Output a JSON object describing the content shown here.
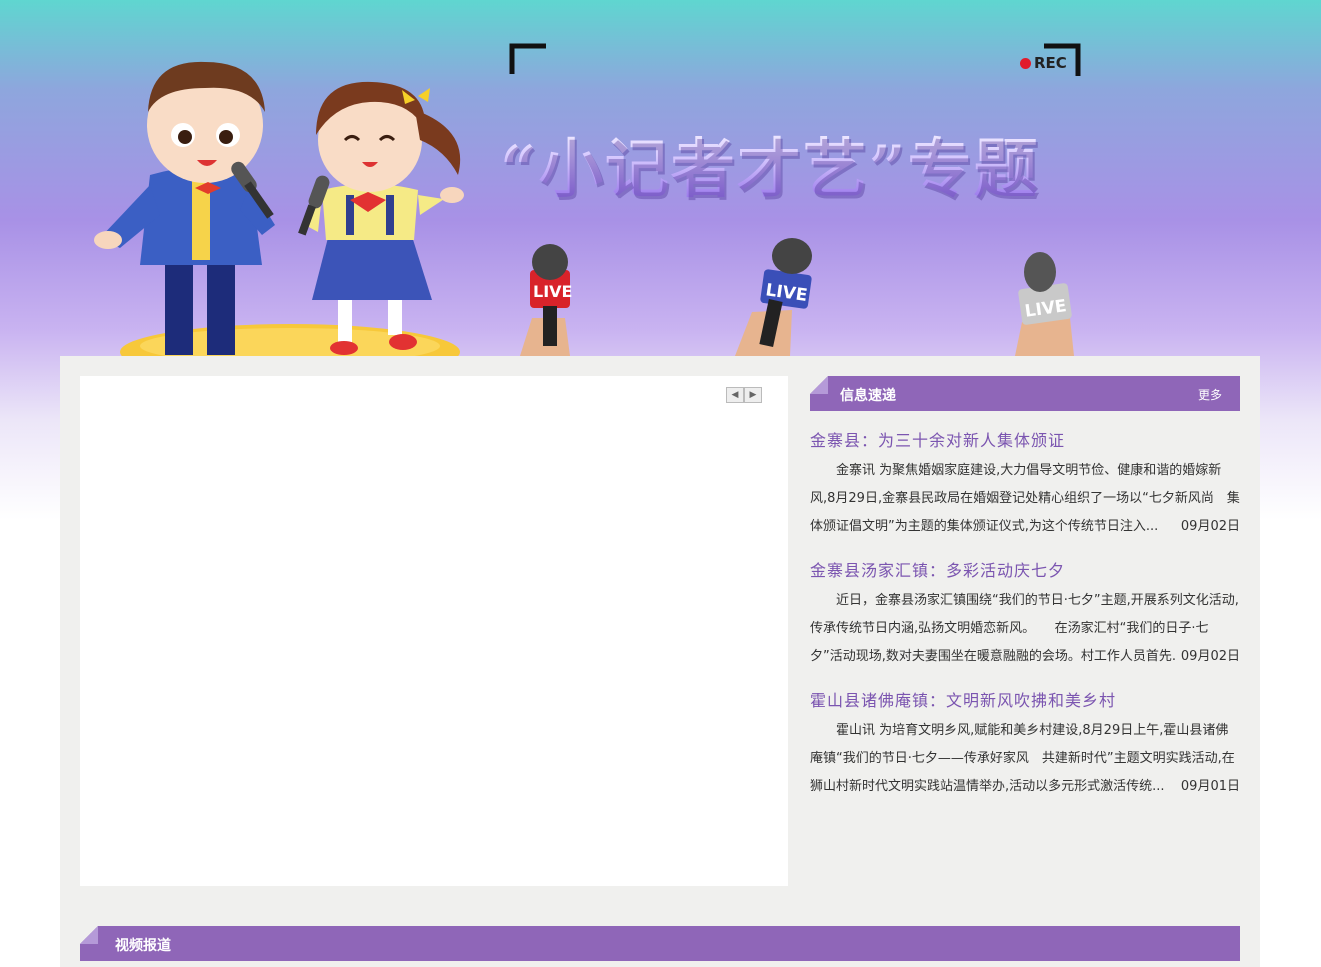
{
  "banner": {
    "title": "“小记者才艺”专题",
    "rec_label": "REC",
    "mic_labels": [
      "LIVE",
      "LIVE",
      "LIVE"
    ]
  },
  "slider": {
    "prev_icon": "triangle-left",
    "next_icon": "triangle-right"
  },
  "news_section": {
    "heading": "信息速递",
    "more_label": "更多",
    "items": [
      {
        "title": "金寨县：为三十余对新人集体颁证",
        "summary": "金寨讯 为聚焦婚姻家庭建设,大力倡导文明节俭、健康和谐的婚嫁新风,8月29日,金寨县民政局在婚姻登记处精心组织了一场以“七夕新风尚　集体颁证倡文明”为主题的集体颁证仪式,为这个传统节日注入...",
        "date": "09月02日"
      },
      {
        "title": "金寨县汤家汇镇：多彩活动庆七夕",
        "summary": "近日，金寨县汤家汇镇围绕“我们的节日·七夕”主题,开展系列文化活动,传承传统节日内涵,弘扬文明婚恋新风。　　在汤家汇村“我们的日子·七夕”活动现场,数对夫妻围坐在暖意融融的会场。村工作人员首先...",
        "date": "09月02日"
      },
      {
        "title": "霍山县诸佛庵镇：文明新风吹拂和美乡村",
        "summary": "霍山讯 为培育文明乡风,赋能和美乡村建设,8月29日上午,霍山县诸佛庵镇“我们的节日·七夕——传承好家风　共建新时代”主题文明实践活动,在狮山村新时代文明实践站温情举办,活动以多元形式激活传统...",
        "date": "09月01日"
      }
    ]
  },
  "video_section": {
    "heading": "视频报道"
  },
  "colors": {
    "accent": "#8f66b8",
    "title_link": "#7b55b0",
    "panel_bg": "#f0f0ee"
  }
}
